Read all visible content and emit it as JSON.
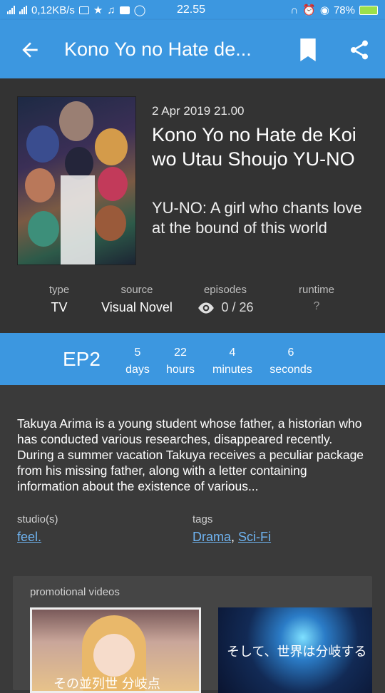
{
  "status_bar": {
    "net_speed": "0,12KB/s",
    "time": "22.55",
    "battery": "78%"
  },
  "app_bar": {
    "title": "Kono Yo no Hate de..."
  },
  "header": {
    "date": "2 Apr 2019 21.00",
    "title": "Kono Yo no Hate de Koi wo Utau Shoujo YU-NO",
    "subtitle": "YU-NO: A girl who chants love at the bound of this world"
  },
  "meta": {
    "type_label": "type",
    "type_value": "TV",
    "source_label": "source",
    "source_value": "Visual Novel",
    "episodes_label": "episodes",
    "episodes_value": "0 / 26",
    "runtime_label": "runtime",
    "runtime_value": "?"
  },
  "countdown": {
    "episode": "EP2",
    "days_value": "5",
    "days_label": "days",
    "hours_value": "22",
    "hours_label": "hours",
    "minutes_value": "4",
    "minutes_label": "minutes",
    "seconds_value": "6",
    "seconds_label": "seconds"
  },
  "description": "Takuya Arima is a young student whose father, a historian who has conducted various researches, disappeared recently. During a summer vacation Takuya receives a peculiar package from his missing father, along with a letter containing information about the existence of various...",
  "info": {
    "studio_label": "studio(s)",
    "studio_value": "feel.",
    "tags_label": "tags",
    "tag1": "Drama",
    "tag_sep": ",",
    "tag2": "Sci-Fi"
  },
  "promo": {
    "title": "promotional videos",
    "caption1": "その並列世 分岐点",
    "caption2": "そして、世界は分岐する"
  },
  "colors": {
    "accent": "#3c97e0",
    "background": "#3a3a3a",
    "header_bg": "#333333",
    "link": "#6fb3f0"
  },
  "icons": [
    "back-arrow-icon",
    "bookmark-icon",
    "share-icon",
    "eye-icon"
  ]
}
